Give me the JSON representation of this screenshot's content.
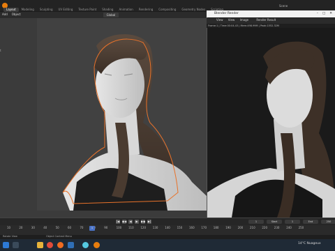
{
  "app": {
    "title": "Blender Render",
    "scene": "Scene",
    "workspace_tabs": [
      "Layout",
      "Modeling",
      "Sculpting",
      "UV Editing",
      "Texture Paint",
      "Shading",
      "Animation",
      "Rendering",
      "Compositing",
      "Geometry Nodes",
      "Scripting"
    ],
    "active_tab_index": 0
  },
  "viewport": {
    "header_items": [
      "Add",
      "Object"
    ],
    "transform": "Global",
    "side_label": "t"
  },
  "render_window": {
    "title": "Blender Render",
    "menu": [
      "View",
      "View",
      "Image",
      "Render Result"
    ],
    "info": "Frame:1 | Time:00:04.43 | Mem:498.99M | Peak:1552.32M",
    "controls": [
      "–",
      "□",
      "✕"
    ]
  },
  "timeline": {
    "ticks": [
      "10",
      "20",
      "30",
      "40",
      "50",
      "60",
      "70",
      "80",
      "90",
      "100",
      "110",
      "120",
      "130",
      "140",
      "150",
      "160",
      "170",
      "180",
      "190",
      "200",
      "210",
      "220",
      "230",
      "240",
      "250"
    ],
    "current_frame": "1",
    "fields": [
      "1",
      "Start",
      "1",
      "End",
      "250"
    ],
    "status_left": "Rotate View",
    "status_mid": "Object Context Menu"
  },
  "taskbar": {
    "weather": "14°C  Nuageux",
    "icons": [
      "windows-icon",
      "search-icon",
      "explorer-icon",
      "chrome-icon",
      "firefox-icon",
      "photoshop-icon",
      "settings-icon",
      "blender-icon"
    ]
  },
  "colors": {
    "accent": "#e87d0d",
    "playhead": "#4a72c5",
    "taskbar": "#1f2a36"
  }
}
